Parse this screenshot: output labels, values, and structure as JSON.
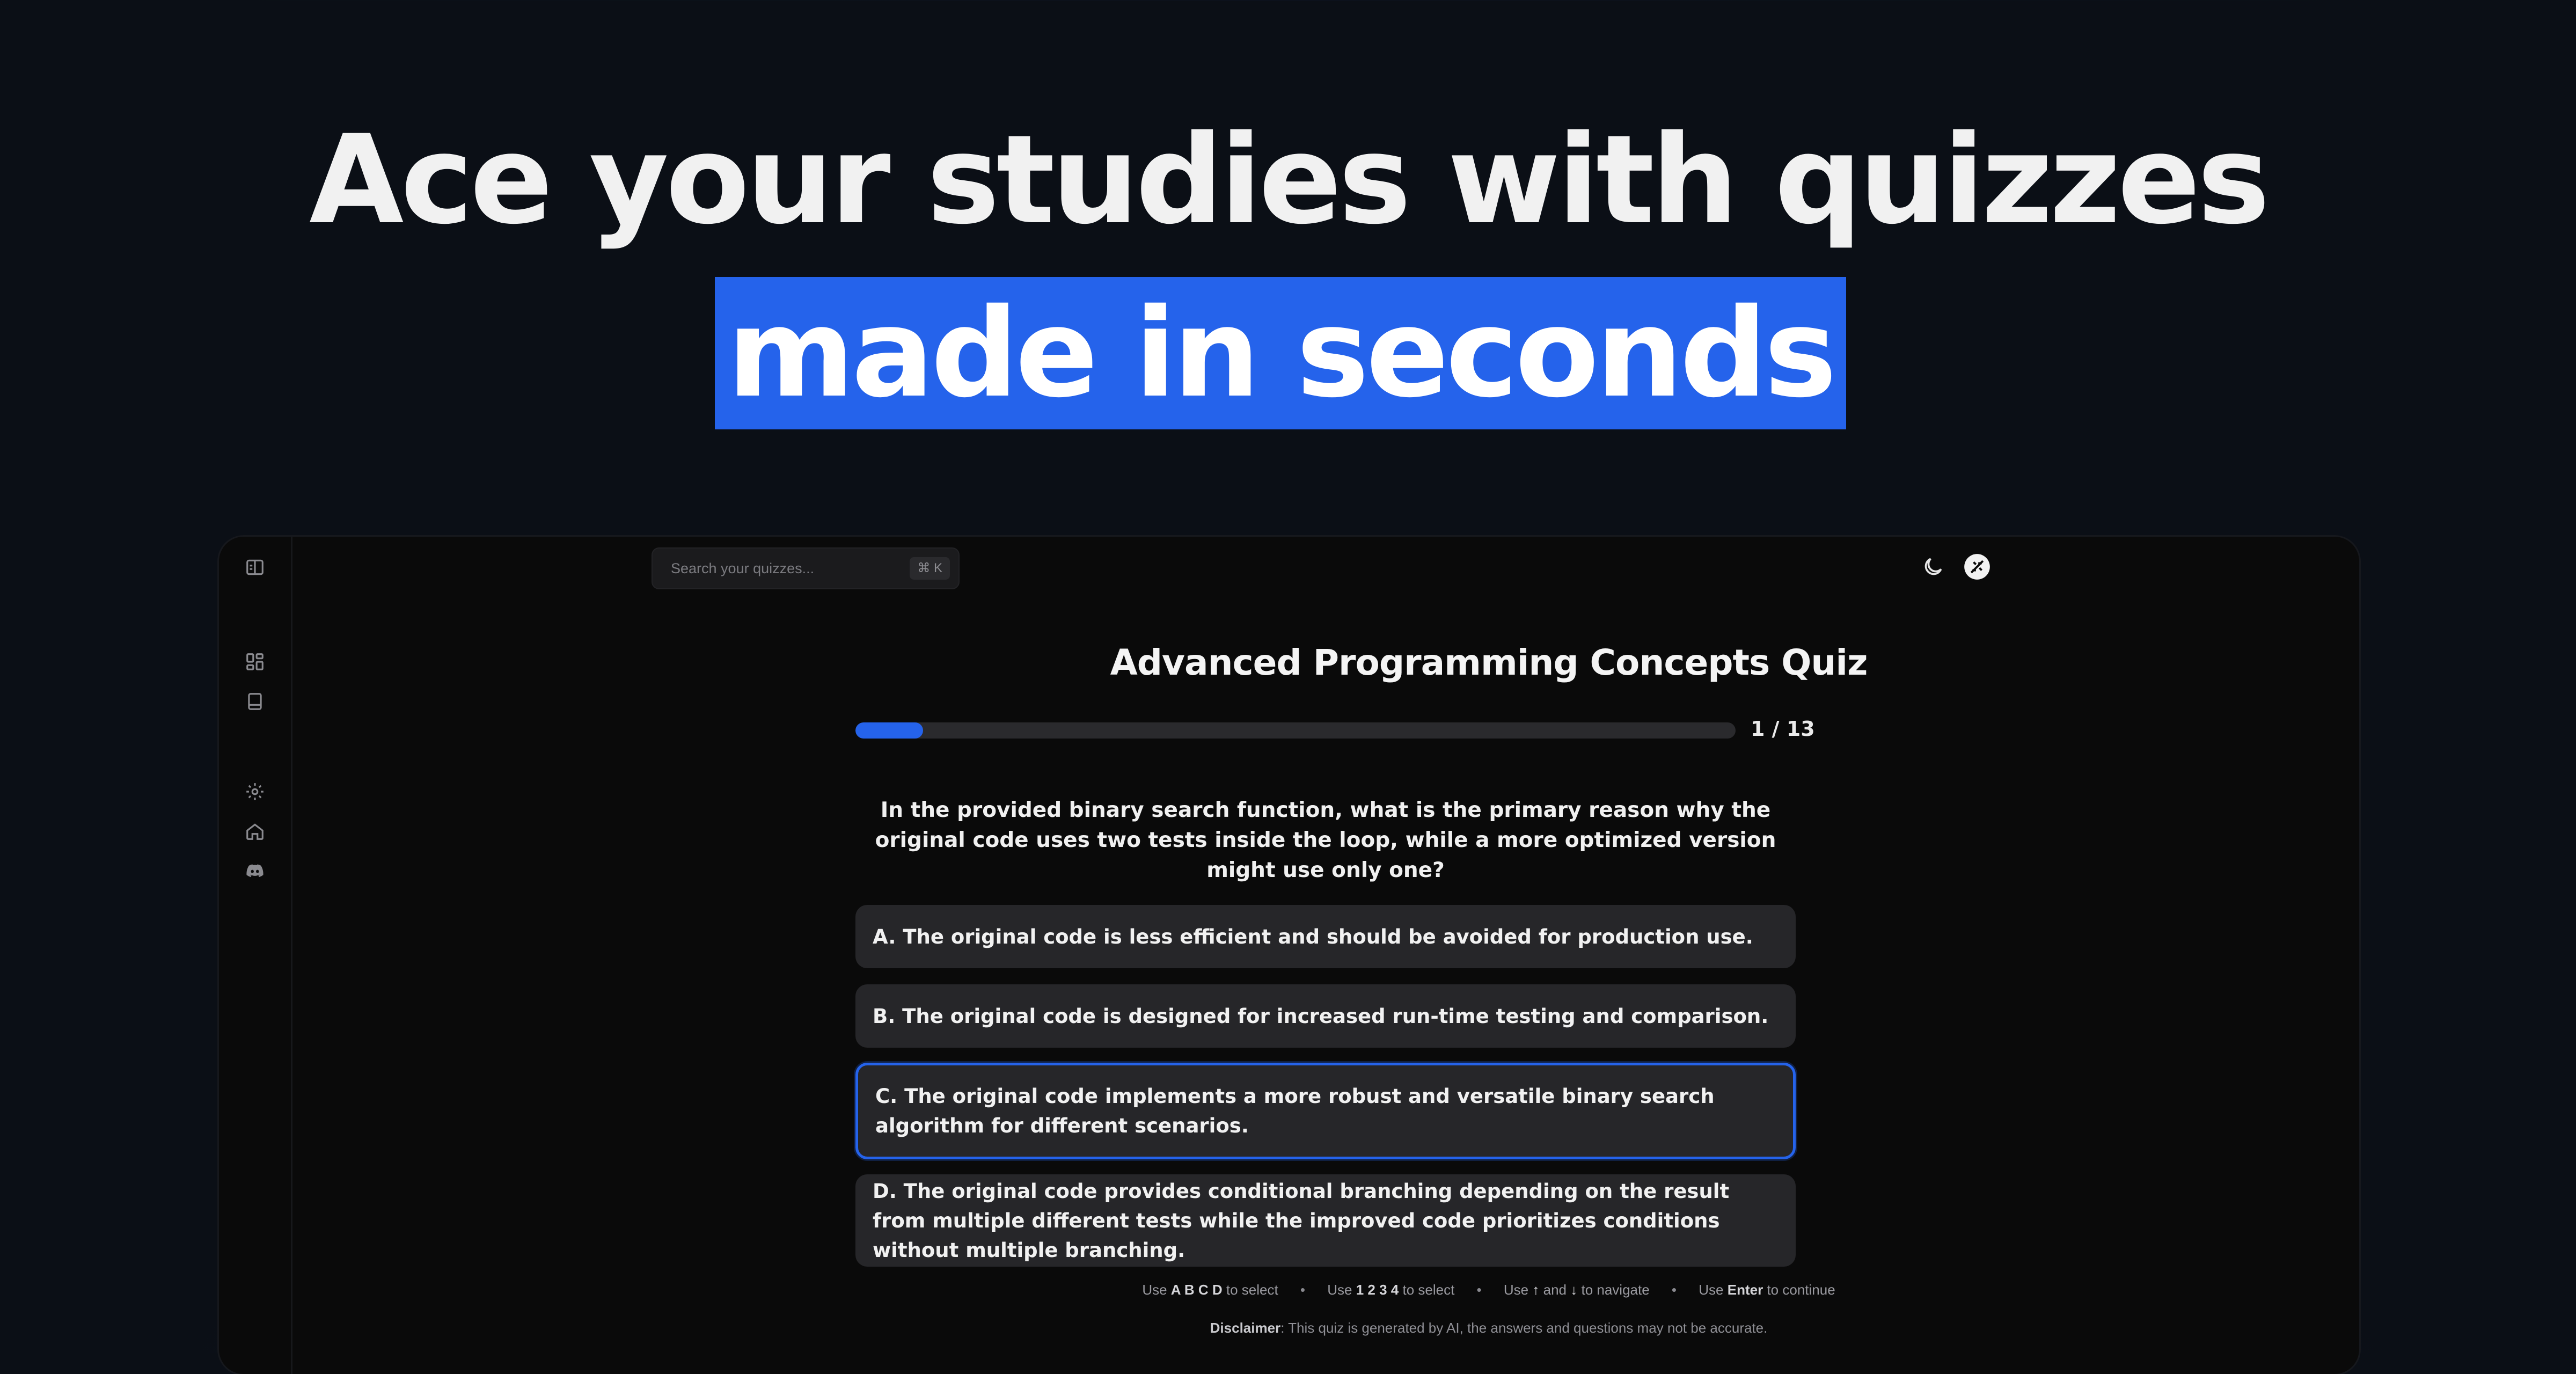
{
  "hero": {
    "line1": "Ace your studies with quizzes",
    "line2": "made in seconds",
    "highlight_color": "#2563eb"
  },
  "sidebar": {
    "items": [
      {
        "icon": "sidebar-toggle-icon"
      },
      {
        "icon": "dashboard-icon"
      },
      {
        "icon": "book-icon"
      },
      {
        "icon": "gear-icon"
      },
      {
        "icon": "home-icon"
      },
      {
        "icon": "discord-icon"
      }
    ]
  },
  "header": {
    "search_placeholder": "Search your quizzes...",
    "search_shortcut": "⌘ K",
    "icons": [
      "moon-icon",
      "profile-icon"
    ]
  },
  "quiz": {
    "title": "Advanced Programming Concepts Quiz",
    "progress_text": "1 / 13",
    "progress_fraction": 0.077,
    "question": "In the provided binary search function, what is the primary reason why the original code uses two tests inside the loop, while a more optimized version might use only one?",
    "options": [
      {
        "label": "A. The original code is less efficient and should be avoided for production use.",
        "selected": false
      },
      {
        "label": "B. The original code is designed for increased run-time testing and comparison.",
        "selected": false
      },
      {
        "label": "C. The original code implements a more robust and versatile binary search algorithm for different scenarios.",
        "selected": true
      },
      {
        "label": "D. The original code provides conditional branching depending on the result from multiple different tests while the improved code prioritizes conditions without multiple branching.",
        "selected": false
      }
    ]
  },
  "hints": {
    "use1": "Use",
    "keys1": "A B C D",
    "after1": "to select",
    "use2": "Use",
    "keys2": "1 2 3 4",
    "after2": "to select",
    "use3": "Use",
    "keys3a": "↑",
    "and": "and",
    "keys3b": "↓",
    "after3": "to navigate",
    "use4": "Use",
    "keys4": "Enter",
    "after4": "to continue",
    "separator": "•"
  },
  "disclaimer": {
    "label": "Disclaimer",
    "text": ": This quiz is generated by AI, the answers and questions may not be accurate."
  }
}
